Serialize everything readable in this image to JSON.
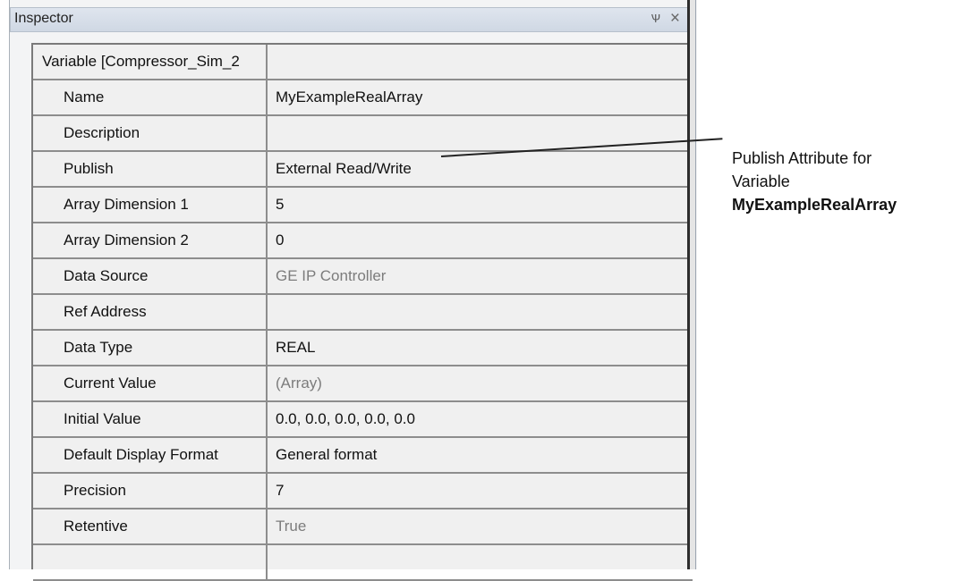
{
  "panel": {
    "title": "Inspector",
    "pin_icon": "pin-icon",
    "close_icon": "close-icon",
    "pin_glyph": "Ѱ",
    "close_glyph": "×"
  },
  "properties": [
    {
      "name": "Variable [Compressor_Sim_2",
      "value": "",
      "indent": false,
      "gray": false
    },
    {
      "name": "Name",
      "value": "MyExampleRealArray",
      "indent": true,
      "gray": false
    },
    {
      "name": "Description",
      "value": "",
      "indent": true,
      "gray": false
    },
    {
      "name": "Publish",
      "value": "External Read/Write",
      "indent": true,
      "gray": false
    },
    {
      "name": "Array Dimension 1",
      "value": "5",
      "indent": true,
      "gray": false
    },
    {
      "name": "Array Dimension 2",
      "value": "0",
      "indent": true,
      "gray": false
    },
    {
      "name": "Data Source",
      "value": "GE IP Controller",
      "indent": true,
      "gray": true
    },
    {
      "name": "Ref Address",
      "value": "",
      "indent": true,
      "gray": false
    },
    {
      "name": "Data Type",
      "value": "REAL",
      "indent": true,
      "gray": false
    },
    {
      "name": "Current Value",
      "value": "(Array)",
      "indent": true,
      "gray": true
    },
    {
      "name": "Initial Value",
      "value": "0.0, 0.0, 0.0, 0.0, 0.0",
      "indent": true,
      "gray": false
    },
    {
      "name": "Default Display Format",
      "value": "General format",
      "indent": true,
      "gray": false
    },
    {
      "name": "Precision",
      "value": "7",
      "indent": true,
      "gray": false
    },
    {
      "name": "Retentive",
      "value": "True",
      "indent": true,
      "gray": true
    },
    {
      "name": "",
      "value": "",
      "indent": true,
      "gray": false
    }
  ],
  "annotation": {
    "line1": "Publish Attribute for",
    "line2": "Variable",
    "line3": "MyExampleRealArray"
  }
}
